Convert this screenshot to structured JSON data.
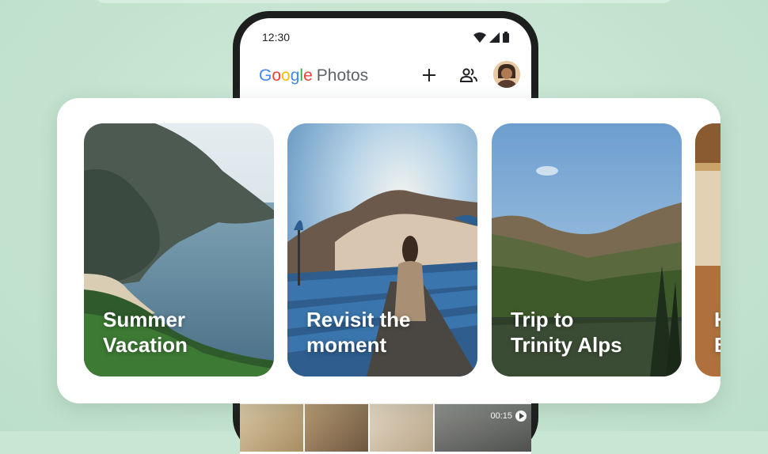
{
  "status_bar": {
    "time": "12:30"
  },
  "app_bar": {
    "logo_google": [
      "G",
      "o",
      "o",
      "g",
      "l",
      "e"
    ],
    "logo_colors": [
      "#4285f4",
      "#ea4335",
      "#fbbc05",
      "#4285f4",
      "#34a853",
      "#ea4335"
    ],
    "logo_photos": "Photos",
    "add_icon": "plus-icon",
    "sharing_icon": "people-icon",
    "avatar_icon": "profile-avatar"
  },
  "memories": [
    {
      "title": "Summer\nVacation"
    },
    {
      "title": "Revisit the\nmoment"
    },
    {
      "title": "Trip to\nTrinity Alps"
    },
    {
      "title": "H\nB"
    }
  ],
  "video_thumbnail": {
    "duration": "00:15"
  },
  "colors": {
    "background": "#c8e6d4",
    "panel": "#ffffff",
    "phone_frame": "#1d1f1e"
  }
}
